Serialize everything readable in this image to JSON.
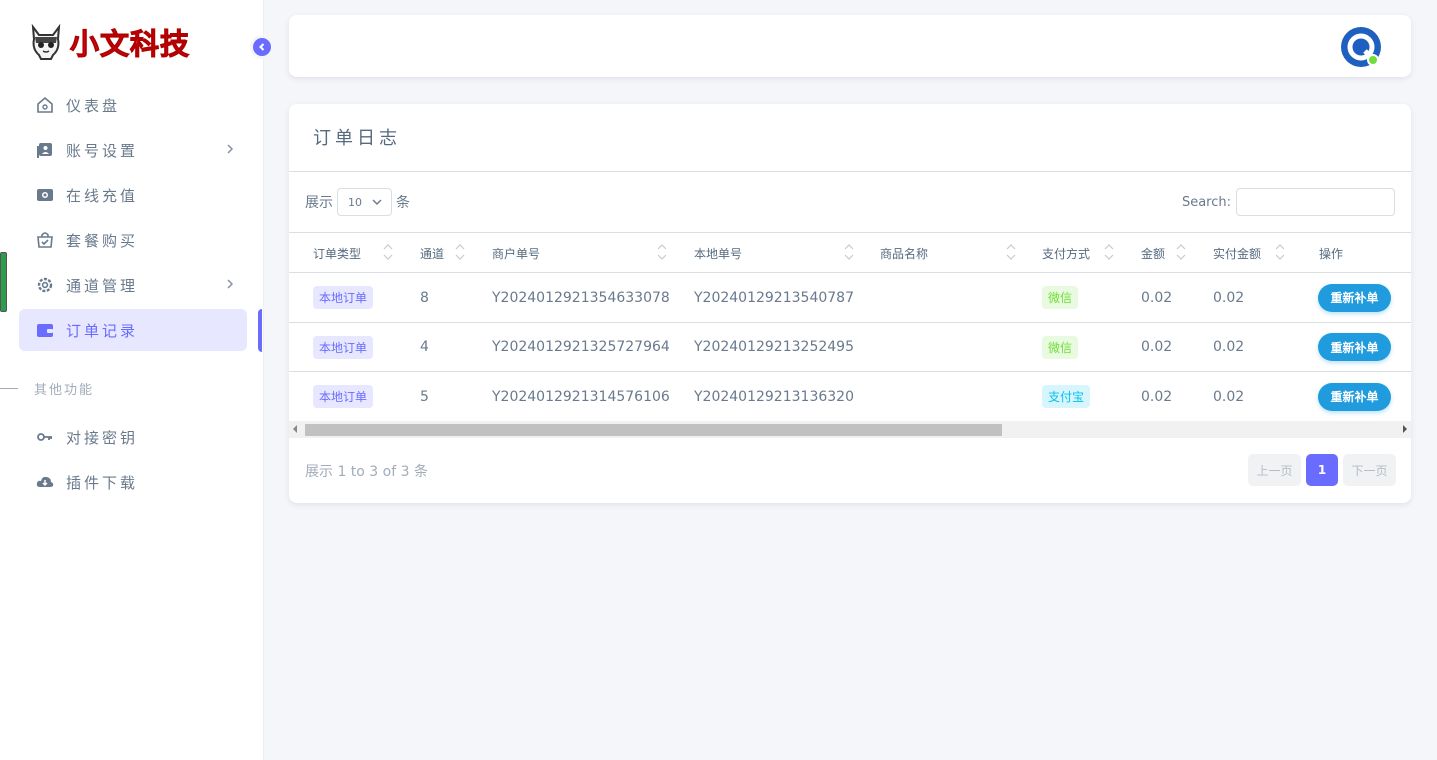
{
  "brand": {
    "name": "小文科技",
    "logo_icon": "cat-mascot-icon",
    "color": "#ee1c25"
  },
  "sidebar": {
    "items": [
      {
        "label": "仪表盘",
        "icon": "home-icon"
      },
      {
        "label": "账号设置",
        "icon": "user-card-icon",
        "has_submenu": true
      },
      {
        "label": "在线充值",
        "icon": "camera-icon"
      },
      {
        "label": "套餐购买",
        "icon": "bag-icon"
      },
      {
        "label": "通道管理",
        "icon": "gear-icon",
        "has_submenu": true
      },
      {
        "label": "订单记录",
        "icon": "wallet-icon",
        "active": true
      }
    ],
    "section_header": "其他功能",
    "items2": [
      {
        "label": "对接密钥",
        "icon": "key-icon"
      },
      {
        "label": "插件下载",
        "icon": "cloud-download-icon"
      }
    ]
  },
  "card": {
    "title": "订单日志",
    "length_prefix": "展示",
    "length_value": "10",
    "length_suffix": "条",
    "search_label": "Search:",
    "search_value": ""
  },
  "table": {
    "columns": [
      "订单类型",
      "通道",
      "商户单号",
      "本地单号",
      "商品名称",
      "支付方式",
      "金额",
      "实付金额",
      "操作"
    ],
    "rows": [
      {
        "type": "本地订单",
        "channel": "8",
        "merchant_no": "Y2024012921354633078",
        "local_no": "Y20240129213540787",
        "product": "",
        "pay": "微信",
        "pay_style": "green",
        "amount": "0.02",
        "paid": "0.02",
        "action": "重新补单"
      },
      {
        "type": "本地订单",
        "channel": "4",
        "merchant_no": "Y2024012921325727964",
        "local_no": "Y20240129213252495",
        "product": "",
        "pay": "微信",
        "pay_style": "green",
        "amount": "0.02",
        "paid": "0.02",
        "action": "重新补单"
      },
      {
        "type": "本地订单",
        "channel": "5",
        "merchant_no": "Y2024012921314576106",
        "local_no": "Y20240129213136320",
        "product": "",
        "pay": "支付宝",
        "pay_style": "cyan",
        "amount": "0.02",
        "paid": "0.02",
        "action": "重新补单"
      }
    ]
  },
  "footer": {
    "info": "展示 1 to 3 of 3 条",
    "prev": "上一页",
    "page": "1",
    "next": "下一页"
  },
  "colors": {
    "primary": "#696cff",
    "action": "#1f9bde"
  }
}
